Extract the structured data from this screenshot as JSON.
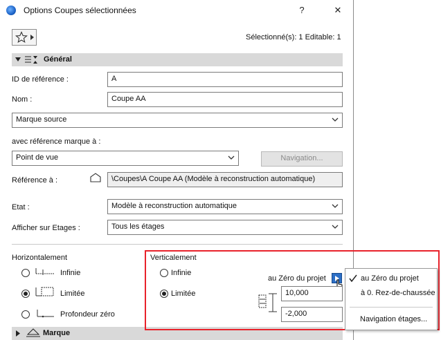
{
  "window": {
    "title": "Options Coupes sélectionnées",
    "help_label": "?",
    "close_label": "✕"
  },
  "toolbar": {
    "selection_status": "Sélectionné(s): 1 Editable: 1"
  },
  "general_section": {
    "title": "Général",
    "id_label": "ID de référence :",
    "id_value": "A",
    "name_label": "Nom :",
    "name_value": "Coupe AA",
    "marker_type": "Marque source",
    "ref_marker_label": "avec référence marque à :",
    "ref_marker_value": "Point de vue",
    "navigation_button": "Navigation...",
    "reference_label": "Référence à :",
    "reference_value": "\\Coupes\\A Coupe AA (Modèle à reconstruction automatique)",
    "status_label": "Etat :",
    "status_value": "Modèle à reconstruction automatique",
    "stories_label": "Afficher sur Etages :",
    "stories_value": "Tous les étages"
  },
  "horizontal": {
    "title": "Horizontalement",
    "options": [
      "Infinie",
      "Limitée",
      "Profondeur zéro"
    ],
    "selected": "Limitée"
  },
  "vertical": {
    "title": "Verticalement",
    "options": [
      "Infinie",
      "Limitée"
    ],
    "selected": "Limitée",
    "reference_label": "au Zéro du projet",
    "top_value": "10,000",
    "bottom_value": "-2,000"
  },
  "reference_menu": {
    "items": [
      "au Zéro du projet",
      "à 0. Rez-de-chaussée"
    ],
    "checked": "au Zéro du projet",
    "footer": "Navigation étages..."
  },
  "marker_section": {
    "title": "Marque"
  },
  "colors": {
    "highlight": "#e8212a",
    "section_bg": "#d9d9d9"
  }
}
